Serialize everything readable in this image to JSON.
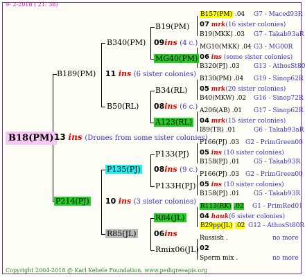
{
  "header": {
    "date": "9-  2-2018 ( 21: 38)"
  },
  "footer": {
    "copyright": "Copyright 2004-2018 @ Karl Kehele Foundation.",
    "url": "www.pedigreeapis.org"
  },
  "root": {
    "name": "B18(PM)",
    "num": "13",
    "ins": "ins",
    "note": "(Drones from some sister colonies)"
  },
  "gen1": [
    {
      "name": "B189(PM)",
      "num": "11",
      "ins": "ins",
      "note": "(6 sister colonies)"
    },
    {
      "name": "P214(PJ)",
      "num": "10",
      "ins": "ins",
      "note": "(3 sister colonies)"
    }
  ],
  "gen2": [
    {
      "name": "B340(PM)",
      "num": "09",
      "ins": "ins",
      "note": "(4 c.)"
    },
    {
      "name": "B50(RL)",
      "num": "08",
      "ins": "ins",
      "note": "(6 c.)"
    },
    {
      "name": "P135(PJ)",
      "num": "08",
      "ins": "ins",
      "note": "(9 c.)"
    },
    {
      "name": "R85(JL)",
      "num": "06",
      "ins": "ins",
      "note": ""
    }
  ],
  "gen3": [
    {
      "name": "B19(PM)"
    },
    {
      "name": "MG40(PM)"
    },
    {
      "name": "B34(RL)"
    },
    {
      "name": "A123(RL)"
    },
    {
      "name": "P133(PJ)"
    },
    {
      "name": "P133H(PJ)"
    },
    {
      "name": "R84(JL)"
    },
    {
      "name": "Rmix06(JL)"
    }
  ],
  "gen4": [
    {
      "top": {
        "name": "B157(PM)",
        "val": ".04",
        "blue": "G7 - Maced93R"
      },
      "num": "07",
      "ins": "mrk",
      "note": "(16 sister colonies)",
      "bot": {
        "name": "B19(MKK)",
        "val": ".03",
        "blue": "G7 - Takab93aR"
      }
    },
    {
      "top": {
        "name": "MG10(MKK)",
        "val": ".04",
        "blue": "G3 - MG00R"
      },
      "num": "06",
      "ins": "ins",
      "note": "(some sister colonies)",
      "bot": {
        "name": "B320(PJ)",
        "val": ".03",
        "blue": "G13 - AthosSt80R"
      }
    },
    {
      "top": {
        "name": "B130(PM)",
        "val": ".04",
        "blue": "G19 - Sinop62R"
      },
      "num": "05",
      "ins": "mrk",
      "note": "(20 sister colonies)",
      "bot": {
        "name": "B40(MKW)",
        "val": ".02",
        "blue": "G16 - Sinop72R"
      }
    },
    {
      "top": {
        "name": "A206(AB)",
        "val": ".01",
        "blue": "G17 - Sinop62R"
      },
      "num": "04",
      "ins": "mrk",
      "note": "(15 sister colonies)",
      "bot": {
        "name": "I89(TR)",
        "val": ".01",
        "blue": "G6 - Takab93aR"
      }
    },
    {
      "top": {
        "name": "P166(PJ)",
        "val": ".03",
        "blue": "G2 - PrimGreen00"
      },
      "num": "05",
      "ins": "ins",
      "note": "(10 sister colonies)",
      "bot": {
        "name": "B158(PJ)",
        "val": ".01",
        "blue": "G5 - Takab93R"
      }
    },
    {
      "top": {
        "name": "P166(PJ)",
        "val": ".03",
        "blue": "G2 - PrimGreen00"
      },
      "num": "05",
      "ins": "ins",
      "note": "(10 sister colonies)",
      "bot": {
        "name": "B158(PJ)",
        "val": ".01",
        "blue": "G5 - Takab93R"
      }
    },
    {
      "top": {
        "name": "R113(RK)",
        "val": ".02",
        "blue": "G1 - PrimRed01"
      },
      "num": "04",
      "ins": "hauk",
      "note": "(6 sister colonies)",
      "bot": {
        "name": "B29pp(JL)",
        "val": ".02",
        "blue": "G12 - AthosSt80R"
      }
    },
    {
      "top": {
        "name": "Russish",
        "val": ".",
        "blue": "no more"
      },
      "num": "02",
      "ins": "",
      "note": "",
      "bot": {
        "name": "Sperm mix",
        "val": ".",
        "blue": "no more"
      }
    }
  ],
  "colors": {
    "frame": "#7c2e8a",
    "green": "#22cc22",
    "cyan": "#22eeee",
    "yellow": "#ffff00",
    "grey": "#bbbbbb",
    "root": "#f7c8f3",
    "ins": "#dd0000",
    "blue": "#3333cc"
  }
}
